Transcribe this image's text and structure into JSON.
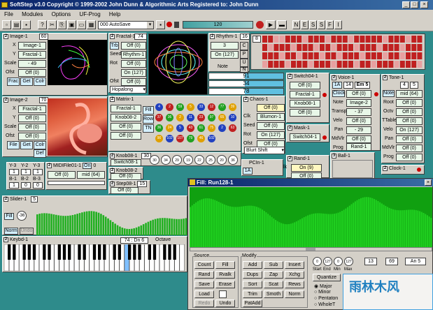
{
  "window": {
    "title": "SoftStep v3.0  Copyright © 1999-2002 John Dunn & Algorithmic Arts   Registered to: John Dunn"
  },
  "menu": [
    "File",
    "Modules",
    "Options",
    "UF-Prog",
    "Help"
  ],
  "toolbar": {
    "autosave": "000 AutoSave",
    "value": "120",
    "letters": [
      "N",
      "E",
      "S",
      "S",
      "F",
      "I"
    ]
  },
  "image1": {
    "num": "2",
    "title": "Image-1",
    "n": "60",
    "x_label": "X",
    "x": "Image-1",
    "y_label": "Y",
    "y": "Fractal-1",
    "scale_label": "Scale",
    "scale": "-  49",
    "ofst_label": "Ofst",
    "ofst": "Off (0)",
    "buttons": [
      "Frac",
      "Get",
      "Colr"
    ],
    "buttons2": [
      "File",
      "Get",
      "Fil",
      "Def"
    ]
  },
  "image2": {
    "num": "2",
    "title": "Image-2",
    "n": "70",
    "x_label": "X",
    "x": "Fractal-1",
    "y_label": "Y",
    "y": "Off (0)",
    "scale_label": "Scale",
    "scale": "Off (0)",
    "ofst_label": "Ofst",
    "ofst": "Off (0)",
    "buttons": [
      "File",
      "Get",
      "Colr"
    ],
    "def": "Def"
  },
  "fractal": {
    "num": "2",
    "title": "Fractal-1",
    "n": "74",
    "trb": "Trb",
    "seed_label": "Seed",
    "rot_label": "Rot",
    "ofst_label": "Ofst",
    "rows": [
      "Off (0)",
      "Rhythm-1",
      "Off (0)",
      "On (127)",
      "Off (0)"
    ],
    "mode": "Hopalong"
  },
  "rhythm": {
    "num": "2",
    "title": "Rhythm-1",
    "n": "16",
    "val": "3",
    "on": "On (127)",
    "note": "Note",
    "grid_n": "8",
    "letters": [
      "C",
      "P",
      "U",
      "N"
    ]
  },
  "counters": [
    "91",
    "34",
    "78"
  ],
  "matrix": {
    "num": "2",
    "title": "Matrix-1",
    "rows": [
      "Fractal-1",
      "Knob08-2",
      "Off (0)",
      "Off (0)"
    ],
    "buttons": [
      "Fill",
      "Row",
      "TN"
    ],
    "balls": [
      "4",
      "2",
      "59",
      "5",
      "33",
      "12",
      "77",
      "39",
      "37",
      "36",
      "2",
      "11",
      "23",
      "97",
      "65",
      "10",
      "36",
      "24",
      "5",
      "43",
      "61",
      "75",
      "2",
      "63",
      "90",
      "102",
      "107",
      "79",
      "46",
      "102"
    ]
  },
  "chaos": {
    "num": "2",
    "title": "Chaos-1",
    "labels": [
      "Clk",
      "Seed",
      "Rot",
      "Ofst"
    ],
    "rows": [
      "Off (0)",
      "Blumon-1",
      "Off (0)",
      "On (127)",
      "Off (0)"
    ],
    "mode": "Blurt Shift"
  },
  "switch": {
    "num": "2",
    "title": "Switch04-1",
    "rows": [
      "Off (0)",
      "Fractal-1",
      "Knob08-1",
      "Off (0)"
    ]
  },
  "mask": {
    "num": "2",
    "title": "Mask-1",
    "row": "Switch04-1"
  },
  "rand": {
    "num": "2",
    "title": "Rand-1",
    "clk": "Clk",
    "on": "On (9)",
    "rows": [
      "Off (0)",
      "Off (0)"
    ]
  },
  "ball": {
    "num": "3",
    "title": "Ball-1"
  },
  "pcin": {
    "title": "PCIn-1",
    "val": "1A"
  },
  "voice": {
    "num": "2",
    "title": "Voice-1",
    "ch": "1A",
    "n": "14",
    "scale": "Em 5",
    "labels": [
      "Clock",
      "Note",
      "Transp",
      "Velo",
      "Pan",
      "MdVlr",
      "Prog"
    ],
    "rows": [
      "Off (0)",
      "Image-2",
      "-  37",
      "Off (0)",
      "-  29",
      "Off (0)",
      "Rand-1"
    ]
  },
  "tone": {
    "num": "2",
    "title": "Tone-1",
    "n": "4",
    "v2": "5",
    "labels": [
      "Note",
      "Root",
      "Octv",
      "TTable",
      "Velo",
      "Pan",
      "MdVlr",
      "Prog"
    ],
    "rows": [
      "mid (64)",
      "Off (0)",
      "Off (0)",
      "Off (0)",
      "On (127)",
      "Off (0)",
      "Off (0)",
      "Off (0)"
    ]
  },
  "clock": {
    "num": "2",
    "title": "Clock-1"
  },
  "knob1": {
    "num": "2",
    "title": "Knob08-1",
    "n": "30",
    "row": "Switch08-1",
    "vals": [
      "30",
      "34",
      "29",
      "19",
      "22",
      "25",
      "20",
      "36"
    ]
  },
  "knob2": {
    "num": "2",
    "title": "Knob08-2",
    "row": "Off (0)"
  },
  "step": {
    "num": "2",
    "title": "Step08-1",
    "n": "15",
    "row": "Off (0)"
  },
  "ygrid": {
    "labels": [
      "Y-3",
      "Y-2",
      "Y-3",
      "B-1",
      "B-2",
      "B-3"
    ],
    "vals": [
      "1",
      "1",
      "1",
      "1",
      "0",
      "0"
    ]
  },
  "midifile": {
    "num": "2",
    "title": "MIDIFile01-1",
    "on": "On",
    "val": "0",
    "rows": [
      "Off (0)",
      "mid (64)"
    ]
  },
  "slider": {
    "num": "2",
    "title": "Slider-1",
    "n": "5",
    "fill": "Fill",
    "val": "-36",
    "norm": "Norm",
    "undo": "Undo"
  },
  "keybd": {
    "num": "2",
    "title": "Keybd-1",
    "range": "74 : Dn 6",
    "octave": "Octave"
  },
  "fillwin": {
    "title": "Fill: Run128-1",
    "source_label": "Source",
    "modify_label": "Modify",
    "source": [
      "Count",
      "Fill",
      "Rand",
      "Rvalk",
      "Save",
      "Erase",
      "Load",
      "",
      "Redo",
      "Undo"
    ],
    "modify": [
      "Add",
      "Sub",
      "Insert",
      "Dups",
      "Zap",
      "Xchg",
      "Sort",
      "Scat",
      "Rews",
      "Trim",
      "Smoth",
      "Norm",
      "PatAdd",
      ""
    ],
    "params": [
      "0",
      "127",
      "0",
      "127",
      "13",
      "69"
    ],
    "param_labels": [
      "Start",
      "End",
      "Min",
      "Max"
    ],
    "an": "An 5",
    "quantize": "Quantize",
    "radios": [
      "Major",
      "Minor",
      "Pentaton",
      "WholeT"
    ]
  },
  "watermark": "雨林木风"
}
